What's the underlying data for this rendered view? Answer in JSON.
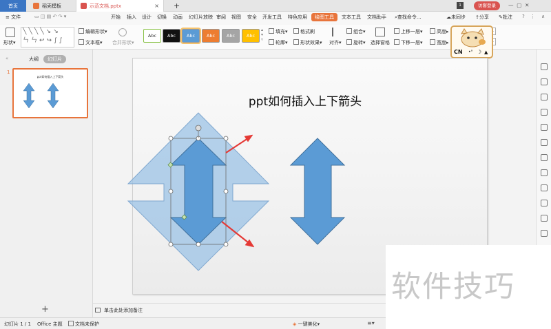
{
  "tabs": {
    "home": "首页",
    "daoke": "稻壳模板",
    "doc": "示范文档.pptx"
  },
  "window": {
    "page_num": "1",
    "visitor": "访客登录"
  },
  "menu": {
    "file": "文件",
    "items": [
      "开始",
      "插入",
      "设计",
      "切换",
      "动画",
      "幻灯片放映",
      "审阅",
      "视图",
      "安全",
      "开发工具",
      "特色应用",
      "绘图工具",
      "文本工具",
      "文档助手"
    ],
    "active": "绘图工具",
    "search": "查找命令...",
    "sync": "未同步",
    "share": "分享",
    "review": "批注"
  },
  "ribbon": {
    "shape": "形状",
    "edit_shape": "编辑形状",
    "textbox": "文本框",
    "merge_shape": "合并形状",
    "style_swatches": [
      {
        "label": "Abc",
        "bg": "#ffffff",
        "fg": "#333333"
      },
      {
        "label": "Abc",
        "bg": "#111111",
        "fg": "#ffffff"
      },
      {
        "label": "Abc",
        "bg": "#5b9bd5",
        "fg": "#ffffff"
      },
      {
        "label": "Abc",
        "bg": "#ed7d31",
        "fg": "#ffffff"
      },
      {
        "label": "Abc",
        "bg": "#a5a5a5",
        "fg": "#ffffff"
      },
      {
        "label": "Abc",
        "bg": "#ffc000",
        "fg": "#ffffff"
      }
    ],
    "fill": "填充",
    "format_brush": "格式刷",
    "outline": "轮廓",
    "shape_effect": "形状效果",
    "align": "对齐",
    "group": "组合",
    "rotate": "旋转",
    "selection_pane": "选择窗格",
    "bring_forward": "上移一层",
    "send_backward": "下移一层",
    "height": "高度",
    "width": "宽度"
  },
  "mascot": {
    "text": "CN",
    "moon": "☽"
  },
  "left_panel": {
    "outline_tab": "大纲",
    "slides_tab": "幻灯片",
    "slide_number": "1",
    "thumb_title": "ppt如何插入上下箭头",
    "add_slide": "+"
  },
  "slide": {
    "title": "ppt如何插入上下箭头"
  },
  "notes": {
    "placeholder": "单击此处添加备注"
  },
  "status": {
    "slide_info": "幻灯片 1 / 1",
    "theme": "Office 主题",
    "protect": "文档未保护",
    "beautify": "一键美化"
  },
  "watermark": {
    "text": "软件技巧"
  },
  "colors": {
    "accent": "#e8743b",
    "arrow_blue": "#5b9bd5",
    "arrow_blue_dark": "#41719c",
    "red_pointer": "#e53935"
  }
}
